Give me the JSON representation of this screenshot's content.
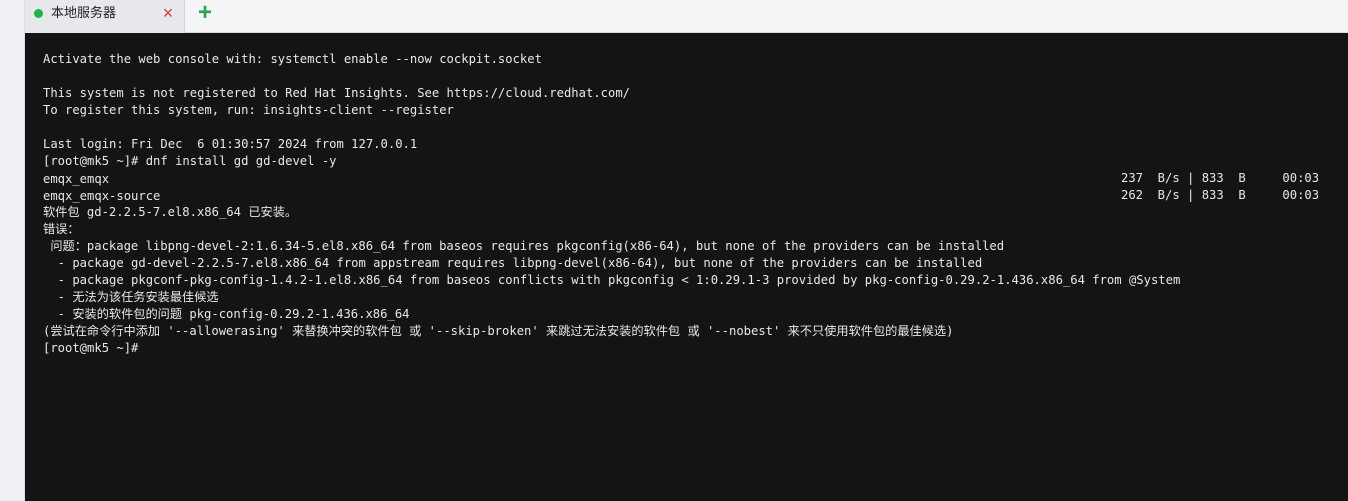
{
  "tab": {
    "title": "本地服务器",
    "status_color": "#1fb34a",
    "close_icon": "×",
    "add_icon": "+"
  },
  "terminal": {
    "lines": [
      "Activate the web console with: systemctl enable --now cockpit.socket",
      "",
      "This system is not registered to Red Hat Insights. See https://cloud.redhat.com/",
      "To register this system, run: insights-client --register",
      "",
      "Last login: Fri Dec  6 01:30:57 2024 from 127.0.0.1",
      "[root@mk5 ~]# dnf install gd gd-devel -y"
    ],
    "repo_lines": [
      {
        "name": "emqx_emqx",
        "meta": "237  B/s | 833  B     00:03"
      },
      {
        "name": "emqx_emqx-source",
        "meta": "262  B/s | 833  B     00:03"
      }
    ],
    "tail_lines": [
      "软件包 gd-2.2.5-7.el8.x86_64 已安装。",
      "错误：",
      " 问题：package libpng-devel-2:1.6.34-5.el8.x86_64 from baseos requires pkgconfig(x86-64), but none of the providers can be installed",
      "  - package gd-devel-2.2.5-7.el8.x86_64 from appstream requires libpng-devel(x86-64), but none of the providers can be installed",
      "  - package pkgconf-pkg-config-1.4.2-1.el8.x86_64 from baseos conflicts with pkgconfig < 1:0.29.1-3 provided by pkg-config-0.29.2-1.436.x86_64 from @System",
      "  - 无法为该任务安装最佳候选",
      "  - 安装的软件包的问题 pkg-config-0.29.2-1.436.x86_64",
      "(尝试在命令行中添加 '--allowerasing' 来替换冲突的软件包 或 '--skip-broken' 来跳过无法安装的软件包 或 '--nobest' 来不只使用软件包的最佳候选)",
      "[root@mk5 ~]#"
    ]
  }
}
